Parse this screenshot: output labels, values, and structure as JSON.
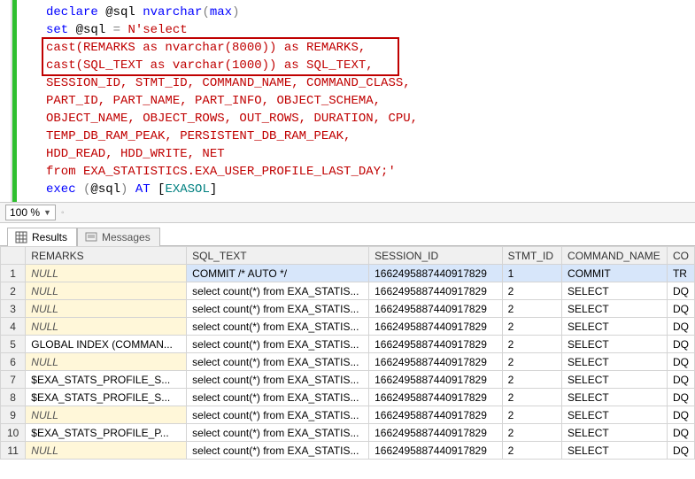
{
  "code": {
    "lines": [
      {
        "segments": [
          {
            "cls": "kw",
            "t": "declare "
          },
          {
            "cls": "var",
            "t": "@sql "
          },
          {
            "cls": "dt",
            "t": "nvarchar"
          },
          {
            "cls": "gray",
            "t": "("
          },
          {
            "cls": "dt",
            "t": "max"
          },
          {
            "cls": "gray",
            "t": ")"
          }
        ]
      },
      {
        "segments": [
          {
            "cls": "kw",
            "t": "set "
          },
          {
            "cls": "var",
            "t": "@sql "
          },
          {
            "cls": "gray",
            "t": "= "
          },
          {
            "cls": "str",
            "t": "N'select "
          }
        ]
      },
      {
        "segments": [
          {
            "cls": "str",
            "t": "cast(REMARKS as nvarchar(8000)) as REMARKS, "
          }
        ]
      },
      {
        "segments": [
          {
            "cls": "str",
            "t": "cast(SQL_TEXT as varchar(1000)) as SQL_TEXT,"
          }
        ]
      },
      {
        "segments": [
          {
            "cls": "str",
            "t": "SESSION_ID, STMT_ID, COMMAND_NAME, COMMAND_CLASS,"
          }
        ]
      },
      {
        "segments": [
          {
            "cls": "str",
            "t": "PART_ID, PART_NAME, PART_INFO, OBJECT_SCHEMA,"
          }
        ]
      },
      {
        "segments": [
          {
            "cls": "str",
            "t": "OBJECT_NAME, OBJECT_ROWS, OUT_ROWS, DURATION, CPU,"
          }
        ]
      },
      {
        "segments": [
          {
            "cls": "str",
            "t": "TEMP_DB_RAM_PEAK, PERSISTENT_DB_RAM_PEAK,"
          }
        ]
      },
      {
        "segments": [
          {
            "cls": "str",
            "t": "HDD_READ, HDD_WRITE, NET"
          }
        ]
      },
      {
        "segments": [
          {
            "cls": "str",
            "t": "from EXA_STATISTICS.EXA_USER_PROFILE_LAST_DAY;'"
          }
        ]
      },
      {
        "segments": [
          {
            "cls": "kw",
            "t": "exec "
          },
          {
            "cls": "gray",
            "t": "("
          },
          {
            "cls": "var",
            "t": "@sql"
          },
          {
            "cls": "gray",
            "t": ")"
          },
          {
            "cls": "kw",
            "t": " AT "
          },
          {
            "cls": "blk",
            "t": "["
          },
          {
            "cls": "teal",
            "t": "EXASOL"
          },
          {
            "cls": "blk",
            "t": "]"
          }
        ]
      }
    ]
  },
  "zoom": "100 %",
  "tabs": {
    "results": "Results",
    "messages": "Messages"
  },
  "grid": {
    "headers": [
      "REMARKS",
      "SQL_TEXT",
      "SESSION_ID",
      "STMT_ID",
      "COMMAND_NAME",
      "CO"
    ],
    "rows": [
      {
        "n": "1",
        "remarks": "NULL",
        "remarks_null": true,
        "sql": "COMMIT /* AUTO */",
        "sess": "1662495887440917829",
        "stmt": "1",
        "cmd": "COMMIT",
        "co": "TR"
      },
      {
        "n": "2",
        "remarks": "NULL",
        "remarks_null": true,
        "sql": "select count(*) from EXA_STATIS...",
        "sess": "1662495887440917829",
        "stmt": "2",
        "cmd": "SELECT",
        "co": "DQ"
      },
      {
        "n": "3",
        "remarks": "NULL",
        "remarks_null": true,
        "sql": "select count(*) from EXA_STATIS...",
        "sess": "1662495887440917829",
        "stmt": "2",
        "cmd": "SELECT",
        "co": "DQ"
      },
      {
        "n": "4",
        "remarks": "NULL",
        "remarks_null": true,
        "sql": "select count(*) from EXA_STATIS...",
        "sess": "1662495887440917829",
        "stmt": "2",
        "cmd": "SELECT",
        "co": "DQ"
      },
      {
        "n": "5",
        "remarks": "GLOBAL INDEX (COMMAN...",
        "remarks_null": false,
        "sql": "select count(*) from EXA_STATIS...",
        "sess": "1662495887440917829",
        "stmt": "2",
        "cmd": "SELECT",
        "co": "DQ"
      },
      {
        "n": "6",
        "remarks": "NULL",
        "remarks_null": true,
        "sql": "select count(*) from EXA_STATIS...",
        "sess": "1662495887440917829",
        "stmt": "2",
        "cmd": "SELECT",
        "co": "DQ"
      },
      {
        "n": "7",
        "remarks": "$EXA_STATS_PROFILE_S...",
        "remarks_null": false,
        "sql": "select count(*) from EXA_STATIS...",
        "sess": "1662495887440917829",
        "stmt": "2",
        "cmd": "SELECT",
        "co": "DQ"
      },
      {
        "n": "8",
        "remarks": "$EXA_STATS_PROFILE_S...",
        "remarks_null": false,
        "sql": "select count(*) from EXA_STATIS...",
        "sess": "1662495887440917829",
        "stmt": "2",
        "cmd": "SELECT",
        "co": "DQ"
      },
      {
        "n": "9",
        "remarks": "NULL",
        "remarks_null": true,
        "sql": "select count(*) from EXA_STATIS...",
        "sess": "1662495887440917829",
        "stmt": "2",
        "cmd": "SELECT",
        "co": "DQ"
      },
      {
        "n": "10",
        "remarks": "$EXA_STATS_PROFILE_P...",
        "remarks_null": false,
        "sql": "select count(*) from EXA_STATIS...",
        "sess": "1662495887440917829",
        "stmt": "2",
        "cmd": "SELECT",
        "co": "DQ"
      },
      {
        "n": "11",
        "remarks": "NULL",
        "remarks_null": true,
        "sql": "select count(*) from EXA_STATIS...",
        "sess": "1662495887440917829",
        "stmt": "2",
        "cmd": "SELECT",
        "co": "DQ"
      }
    ]
  }
}
